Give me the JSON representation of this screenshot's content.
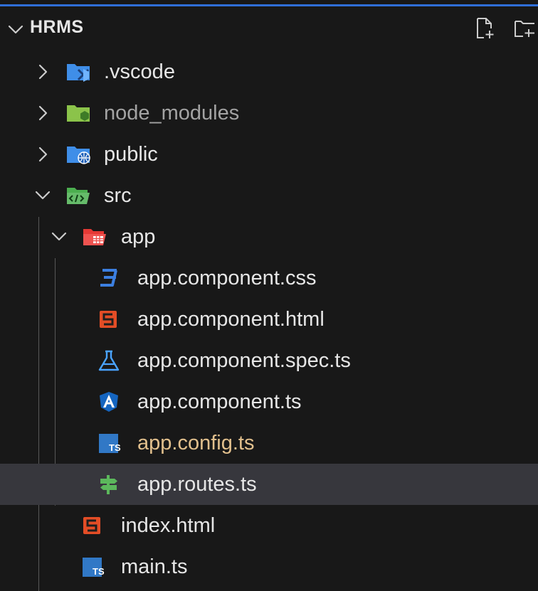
{
  "explorer": {
    "root_title": "HRMS",
    "actions": [
      {
        "name": "new-file",
        "icon": "new-file-icon"
      },
      {
        "name": "new-folder",
        "icon": "new-folder-icon"
      }
    ]
  },
  "tree": [
    {
      "label": ".vscode",
      "kind": "folder",
      "expanded": false,
      "icon": "vscode-folder-icon",
      "depth": 1
    },
    {
      "label": "node_modules",
      "kind": "folder",
      "expanded": false,
      "icon": "node-folder-icon",
      "depth": 1,
      "dimmed": true
    },
    {
      "label": "public",
      "kind": "folder",
      "expanded": false,
      "icon": "public-folder-icon",
      "depth": 1
    },
    {
      "label": "src",
      "kind": "folder",
      "expanded": true,
      "icon": "src-folder-icon",
      "depth": 1
    },
    {
      "label": "app",
      "kind": "folder",
      "expanded": true,
      "icon": "app-folder-icon",
      "depth": 2
    },
    {
      "label": "app.component.css",
      "kind": "file",
      "icon": "css-icon",
      "depth": 3
    },
    {
      "label": "app.component.html",
      "kind": "file",
      "icon": "html-icon",
      "depth": 3
    },
    {
      "label": "app.component.spec.ts",
      "kind": "file",
      "icon": "test-flask-icon",
      "depth": 3
    },
    {
      "label": "app.component.ts",
      "kind": "file",
      "icon": "angular-icon",
      "depth": 3
    },
    {
      "label": "app.config.ts",
      "kind": "file",
      "icon": "typescript-icon",
      "depth": 3,
      "modified": true
    },
    {
      "label": "app.routes.ts",
      "kind": "file",
      "icon": "routes-icon",
      "depth": 3,
      "selected": true
    },
    {
      "label": "index.html",
      "kind": "file",
      "icon": "html-icon",
      "depth": 2
    },
    {
      "label": "main.ts",
      "kind": "file",
      "icon": "typescript-icon",
      "depth": 2
    }
  ],
  "colors": {
    "background": "#181818",
    "selection": "#37373d",
    "accent": "#2f6fd8",
    "modified_text": "#e2c08d",
    "html": "#e44d26",
    "css": "#3c7fe0",
    "typescript": "#3178c6",
    "routes": "#5cb85c"
  }
}
